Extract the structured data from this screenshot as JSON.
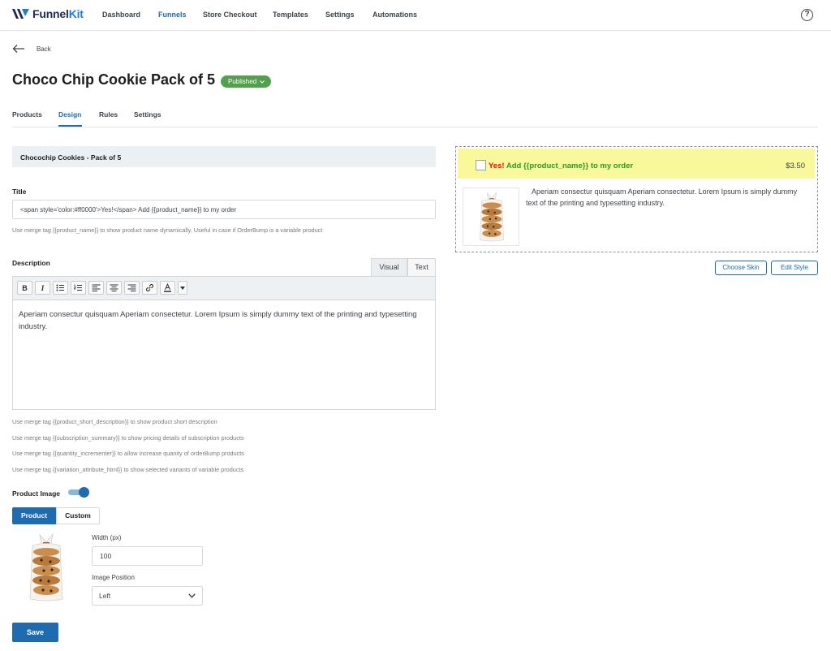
{
  "brand": {
    "name_part1": "Funnel",
    "name_part2": "Kit"
  },
  "nav": {
    "items": [
      "Dashboard",
      "Funnels",
      "Store Checkout",
      "Templates",
      "Settings",
      "Automations"
    ],
    "active": "Funnels",
    "help_icon": "help-icon"
  },
  "back": {
    "label": "Back",
    "icon": "arrow-left-icon"
  },
  "page": {
    "title": "Choco Chip Cookie Pack of 5",
    "status": "Published",
    "status_color": "#53a04c"
  },
  "tabs": {
    "items": [
      "Products",
      "Design",
      "Rules",
      "Settings"
    ],
    "active": "Design"
  },
  "form": {
    "product_header": "Chocochip Cookies - Pack of 5",
    "title_label": "Title",
    "title_value": "<span style='color:#ff0000'>Yes!</span> Add {{product_name}} to my order",
    "title_hint": "Use merge tag {{product_name}} to show product name dynamically. Useful in case if OrderBump is a variable product",
    "description_label": "Description",
    "editor_tabs": [
      "Visual",
      "Text"
    ],
    "editor_toolbar": [
      "bold-icon",
      "italic-icon",
      "bulleted-list-icon",
      "numbered-list-icon",
      "align-left-icon",
      "align-center-icon",
      "align-right-icon",
      "link-icon",
      "text-color-icon",
      "dropdown-arrow-icon"
    ],
    "description_value": "Aperiam consectur quisquam Aperiam consectetur. Lorem Ipsum is simply dummy text of the printing and typesetting industry.",
    "merge_hints": [
      "Use merge tag {{product_short_description}} to show product short description",
      "Use merge tag {{subscription_summary}} to show pricing details of subscription products",
      "Use merge tag {{quantity_incrementer}} to allow increase quanity of orderBump products",
      "Use merge tag {{variation_attribute_html}} to show selected variants of variable products"
    ],
    "product_image_label": "Product Image",
    "product_image_enabled": true,
    "image_source_options": [
      "Product",
      "Custom"
    ],
    "image_source_selected": "Product",
    "width_label": "Width (px)",
    "width_value": "100",
    "position_label": "Image Position",
    "position_value": "Left",
    "save_label": "Save"
  },
  "preview": {
    "title_yes": "Yes!",
    "title_rest": " Add {{product_name}} to my order",
    "price": "$3.50",
    "description": "Aperiam consectur quisquam Aperiam consectetur. Lorem Ipsum is simply dummy text of the printing and typesetting industry.",
    "highlight_color": "#f9f89a",
    "choose_skin_label": "Choose Skin",
    "edit_style_label": "Edit Style"
  },
  "colors": {
    "accent": "#1e6bb0",
    "yes_red": "#ff0000",
    "title_green": "#2a9a2a"
  }
}
